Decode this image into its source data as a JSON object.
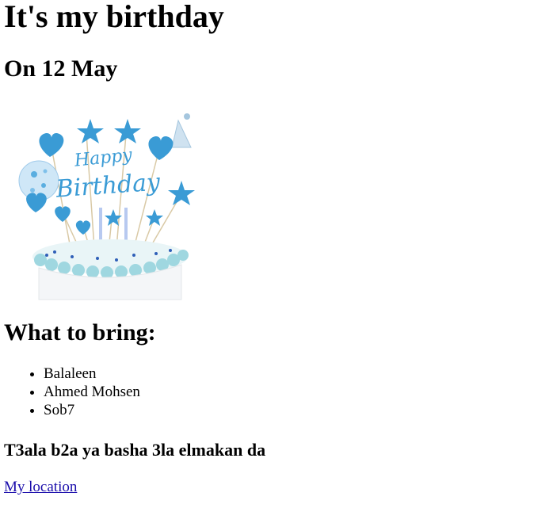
{
  "heading": "It's my birthday",
  "date_heading": "On 12 May",
  "bring_heading": "What to bring:",
  "items": [
    "Balaleen",
    "Ahmed Mohsen",
    "Sob7"
  ],
  "invite_text": "T3ala b2a ya basha 3la elmakan da",
  "location_link": "My location",
  "cake_topper_text": "Happy Birthday",
  "colors": {
    "accent_blue": "#3a9bd5",
    "link": "#1a0dab"
  }
}
